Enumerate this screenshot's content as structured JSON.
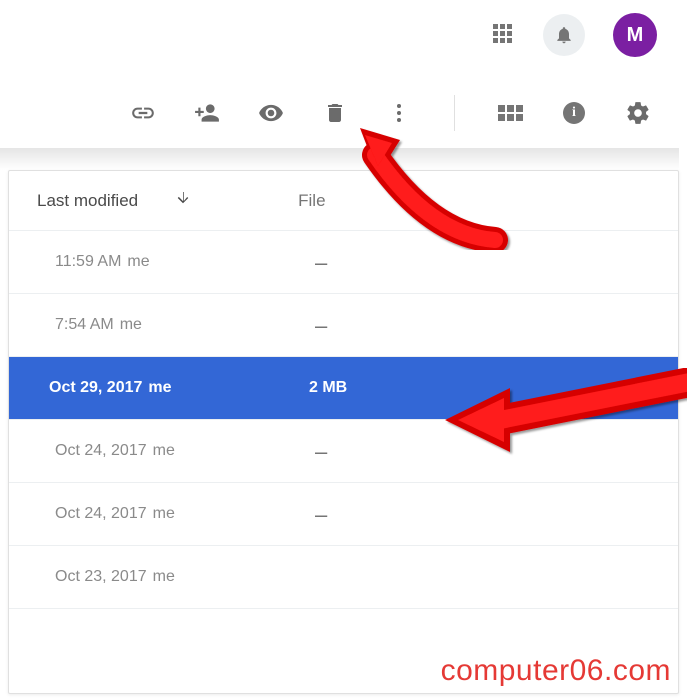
{
  "header": {
    "avatar_initial": "M"
  },
  "columns": {
    "modified_label": "Last modified",
    "size_label": "File"
  },
  "rows": [
    {
      "modified": "11:59 AM",
      "owner": "me",
      "size": "–",
      "selected": false
    },
    {
      "modified": "7:54 AM",
      "owner": "me",
      "size": "–",
      "selected": false
    },
    {
      "modified": "Oct 29, 2017",
      "owner": "me",
      "size": "2 MB",
      "selected": true
    },
    {
      "modified": "Oct 24, 2017",
      "owner": "me",
      "size": "–",
      "selected": false
    },
    {
      "modified": "Oct 24, 2017",
      "owner": "me",
      "size": "–",
      "selected": false
    },
    {
      "modified": "Oct 23, 2017",
      "owner": "me",
      "size": "",
      "selected": false
    }
  ],
  "watermark": "computer06.com"
}
